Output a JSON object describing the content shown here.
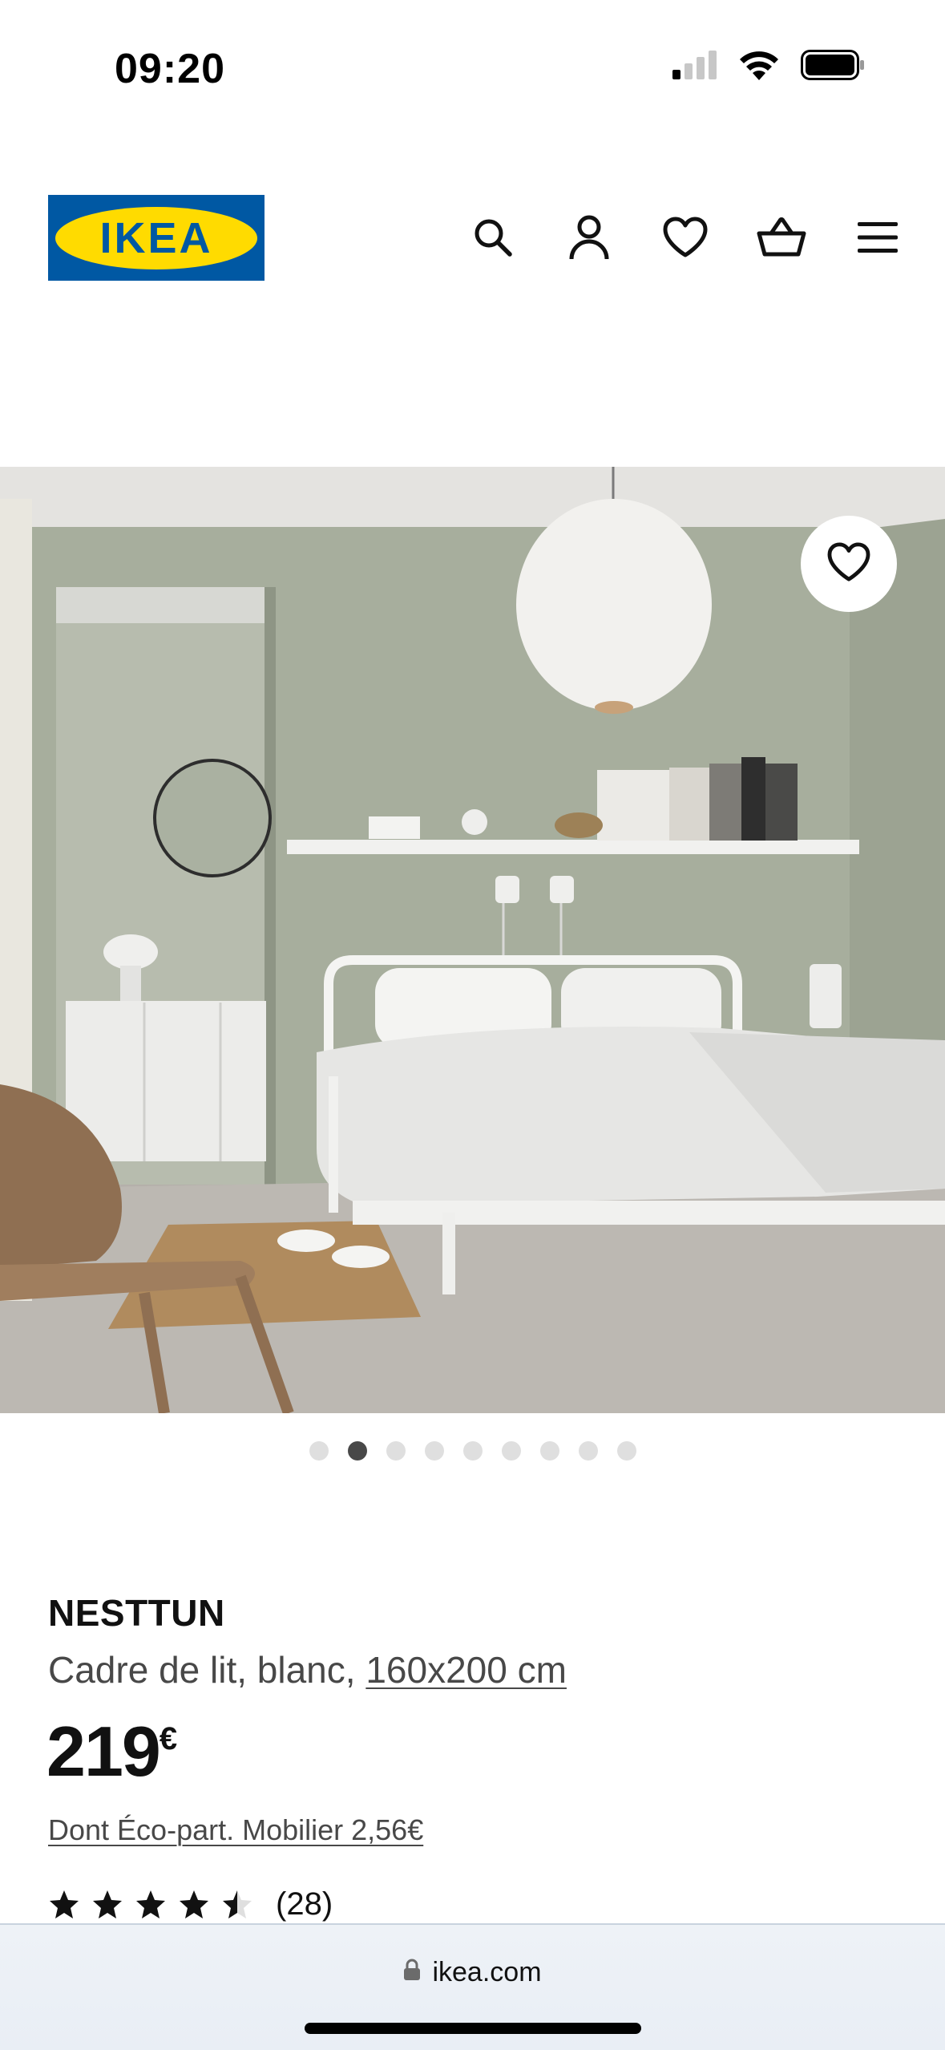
{
  "status_bar": {
    "time": "09:20",
    "icons": [
      "cellular-signal-icon",
      "wifi-icon",
      "battery-icon"
    ]
  },
  "header": {
    "logo_text": "IKEA",
    "icons": [
      "search-icon",
      "account-icon",
      "heart-icon",
      "basket-icon",
      "menu-icon"
    ]
  },
  "carousel": {
    "total_images": 9,
    "active_index": 1,
    "favorite_icon": "heart-outline-icon"
  },
  "product": {
    "name": "NESTTUN",
    "description_prefix": "Cadre de lit, blanc, ",
    "size_link": "160x200 cm",
    "price_amount": "219",
    "price_currency": "€",
    "eco_participation": "Dont Éco-part. Mobilier 2,56€",
    "rating_value": 4.5,
    "rating_max": 5,
    "rating_count": "(28)"
  },
  "browser": {
    "url": "ikea.com",
    "lock_icon": "lock-icon"
  },
  "colors": {
    "ikea_blue": "#0058a3",
    "ikea_yellow": "#ffdb00",
    "text_primary": "#111111",
    "text_secondary": "#484848",
    "dot_active": "#484848",
    "dot_inactive": "#dfdfdf"
  }
}
